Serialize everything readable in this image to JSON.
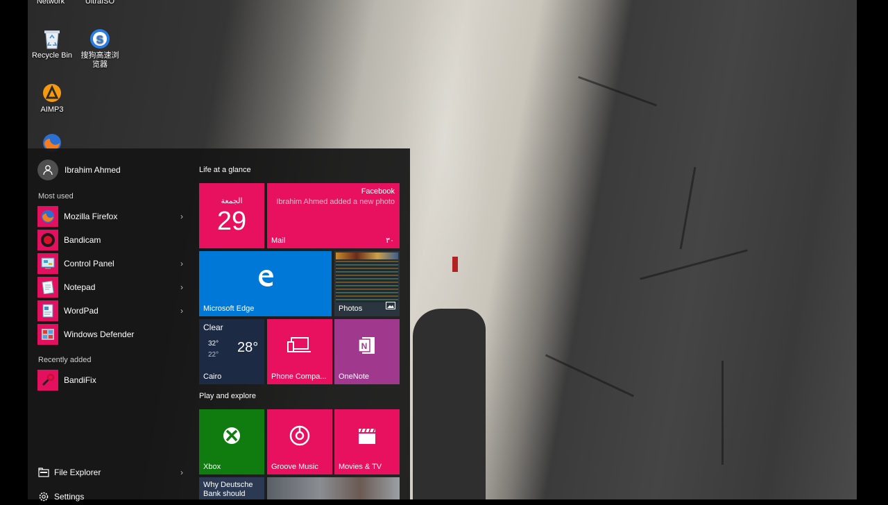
{
  "desktop": {
    "top_icons": [
      "Network",
      "UltraISO"
    ],
    "icons": [
      {
        "label": "Recycle Bin",
        "icon": "recycle-bin-icon"
      },
      {
        "label": "搜狗高速浏览器",
        "label_line1": "搜狗高速浏",
        "label_line2": "览器",
        "icon": "sogou-browser-icon"
      },
      {
        "label": "AIMP3",
        "icon": "aimp-icon"
      },
      {
        "label": "",
        "icon": "firefox-icon"
      }
    ]
  },
  "start_menu": {
    "user_name": "Ibrahim Ahmed",
    "most_used_label": "Most used",
    "most_used": [
      {
        "label": "Mozilla Firefox",
        "icon": "firefox-icon",
        "has_submenu": true
      },
      {
        "label": "Bandicam",
        "icon": "bandicam-icon",
        "has_submenu": false
      },
      {
        "label": "Control Panel",
        "icon": "control-panel-icon",
        "has_submenu": true
      },
      {
        "label": "Notepad",
        "icon": "notepad-icon",
        "has_submenu": true
      },
      {
        "label": "WordPad",
        "icon": "wordpad-icon",
        "has_submenu": true
      },
      {
        "label": "Windows Defender",
        "icon": "windows-defender-icon",
        "has_submenu": false
      }
    ],
    "recently_added_label": "Recently added",
    "recently_added": [
      {
        "label": "BandiFix",
        "icon": "bandifix-icon"
      }
    ],
    "bottom": [
      {
        "label": "File Explorer",
        "icon": "file-explorer-icon",
        "has_submenu": true
      },
      {
        "label": "Settings",
        "icon": "settings-icon"
      }
    ],
    "groups": [
      {
        "title": "Life at a glance"
      },
      {
        "title": "Play and explore"
      }
    ],
    "tiles": {
      "calendar": {
        "day_name": "الجمعة",
        "day_number": "29"
      },
      "mail": {
        "source": "Facebook",
        "message": "Ibrahim Ahmed added a new photo",
        "name": "Mail",
        "count": "٣٠"
      },
      "edge": {
        "name": "Microsoft Edge"
      },
      "photos": {
        "name": "Photos"
      },
      "weather": {
        "condition": "Clear",
        "high": "32°",
        "low": "22°",
        "current": "28°",
        "city": "Cairo"
      },
      "phone_companion": {
        "name": "Phone Compa..."
      },
      "onenote": {
        "name": "OneNote"
      },
      "xbox": {
        "name": "Xbox"
      },
      "groove": {
        "name": "Groove Music"
      },
      "movies": {
        "name": "Movies & TV"
      },
      "news": {
        "headline_line1": "Why Deutsche",
        "headline_line2": "Bank should"
      }
    },
    "colors": {
      "accent": "#e8115f",
      "edge_blue": "#0078d7",
      "xbox_green": "#107c10",
      "onenote_purple": "#a0388e",
      "weather_navy": "#1c2a44"
    }
  }
}
